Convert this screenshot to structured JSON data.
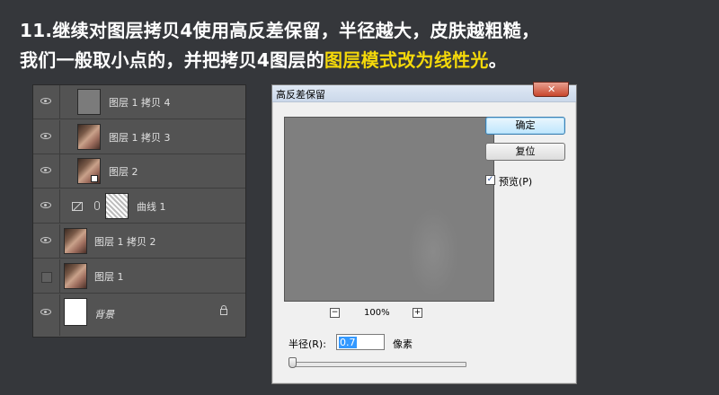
{
  "caption": {
    "line1": "11.继续对图层拷贝4使用高反差保留，半径越大，皮肤越粗糙，",
    "line2_prefix": "我们一般取小点的，并把拷贝4图层的",
    "line2_highlight": "图层模式改为线性光",
    "line2_suffix": "。",
    "highlight_color": "#f5d90a"
  },
  "layers_panel": {
    "layers": [
      {
        "name": "图层 1 拷贝 4",
        "visible": true,
        "thumbnail": "gray"
      },
      {
        "name": "图层 1 拷贝 3",
        "visible": true,
        "thumbnail": "portrait"
      },
      {
        "name": "图层 2",
        "visible": true,
        "thumbnail": "portrait"
      },
      {
        "name": "曲线 1",
        "visible": true,
        "thumbnail": "curves-mask"
      },
      {
        "name": "图层 1 拷贝 2",
        "visible": true,
        "thumbnail": "portrait"
      },
      {
        "name": "图层 1",
        "visible": false,
        "thumbnail": "portrait"
      },
      {
        "name": "背景",
        "visible": true,
        "thumbnail": "white",
        "locked": true
      }
    ]
  },
  "dialog": {
    "title": "高反差保留",
    "close_icon": "close-icon",
    "ok_label": "确定",
    "reset_label": "复位",
    "preview_checkbox": {
      "label": "预览(P)",
      "checked": true
    },
    "zoom": {
      "level": "100%",
      "minus": "−",
      "plus": "+"
    },
    "radius": {
      "label": "半径(R):",
      "value": "0.7",
      "unit": "像素"
    },
    "slider_value": 0.7
  }
}
